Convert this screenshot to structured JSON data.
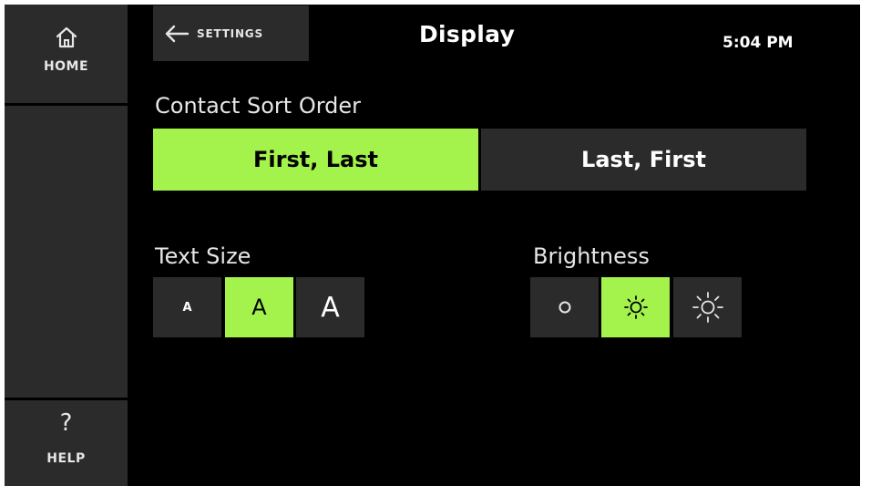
{
  "sidebar": {
    "home_label": "HOME",
    "help_label": "HELP",
    "help_glyph": "?"
  },
  "header": {
    "back_label": "SETTINGS",
    "title": "Display",
    "time": "5:04 PM"
  },
  "contact_sort": {
    "label": "Contact Sort Order",
    "options": [
      "First, Last",
      "Last, First"
    ],
    "selected": "First, Last"
  },
  "text_size": {
    "label": "Text Size",
    "options": [
      "A",
      "A",
      "A"
    ],
    "selected_index": 1
  },
  "brightness": {
    "label": "Brightness",
    "options": [
      "low-brightness-icon",
      "medium-brightness-icon",
      "high-brightness-icon"
    ],
    "selected_index": 1
  },
  "colors": {
    "accent": "#a3f34c",
    "button_bg": "#2b2b2b",
    "background": "#000000"
  }
}
